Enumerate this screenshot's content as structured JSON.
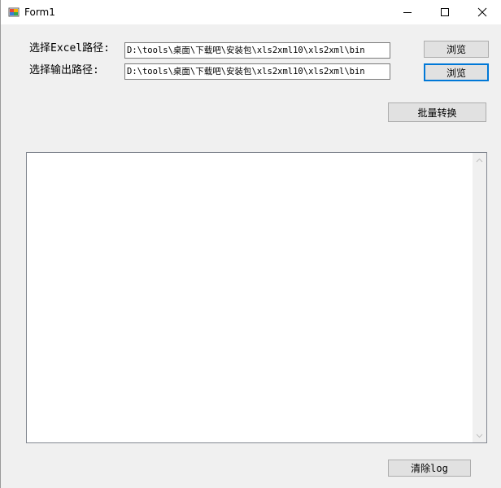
{
  "window": {
    "title": "Form1",
    "icons": {
      "app": "form-app-icon",
      "minimize": "minimize-icon",
      "maximize": "maximize-icon",
      "close": "close-icon"
    }
  },
  "form": {
    "excel_path_label": "选择Excel路径:",
    "excel_path_value": "D:\\tools\\桌面\\下载吧\\安装包\\xls2xml10\\xls2xml\\bin",
    "browse_excel_label": "浏览",
    "output_path_label": "选择输出路径:",
    "output_path_value": "D:\\tools\\桌面\\下载吧\\安装包\\xls2xml10\\xls2xml\\bin",
    "browse_output_label": "浏览",
    "batch_convert_label": "批量转换",
    "log_text": "",
    "clear_log_label": "清除log"
  },
  "colors": {
    "window_bg": "#f0f0f0",
    "titlebar_bg": "#ffffff",
    "button_bg": "#e1e1e1",
    "focus_border": "#0078d7"
  }
}
